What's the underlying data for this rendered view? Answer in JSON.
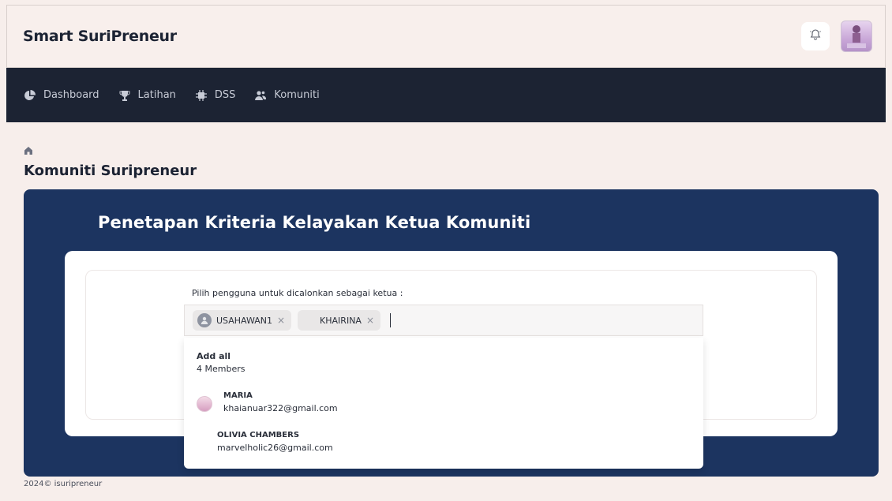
{
  "header": {
    "brand": "Smart SuriPreneur"
  },
  "nav": {
    "items": [
      {
        "label": "Dashboard",
        "icon": "pie-chart-icon"
      },
      {
        "label": "Latihan",
        "icon": "trophy-icon"
      },
      {
        "label": "DSS",
        "icon": "chip-icon"
      },
      {
        "label": "Komuniti",
        "icon": "users-icon"
      }
    ]
  },
  "breadcrumb": {
    "icon": "home-icon"
  },
  "page": {
    "title": "Komuniti Suripreneur",
    "hero_title": "Penetapan Kriteria Kelayakan Ketua Komuniti"
  },
  "form": {
    "label": "Pilih pengguna untuk dicalonkan sebagai ketua :",
    "chips": [
      {
        "label": "USAHAWAN1",
        "remove": "×"
      },
      {
        "label": "KHAIRINA",
        "remove": "×"
      }
    ],
    "dropdown": {
      "add_all": "Add all",
      "count": "4 Members",
      "items": [
        {
          "name": "MARIA",
          "email": "khaianuar322@gmail.com"
        },
        {
          "name": "OLIVIA CHAMBERS",
          "email": "marvelholic26@gmail.com"
        }
      ]
    }
  },
  "footer": {
    "text": "2024© isuripreneur"
  },
  "colors": {
    "navbar": "#1c2333",
    "hero": "#1c3460",
    "background": "#f7eeeb"
  }
}
